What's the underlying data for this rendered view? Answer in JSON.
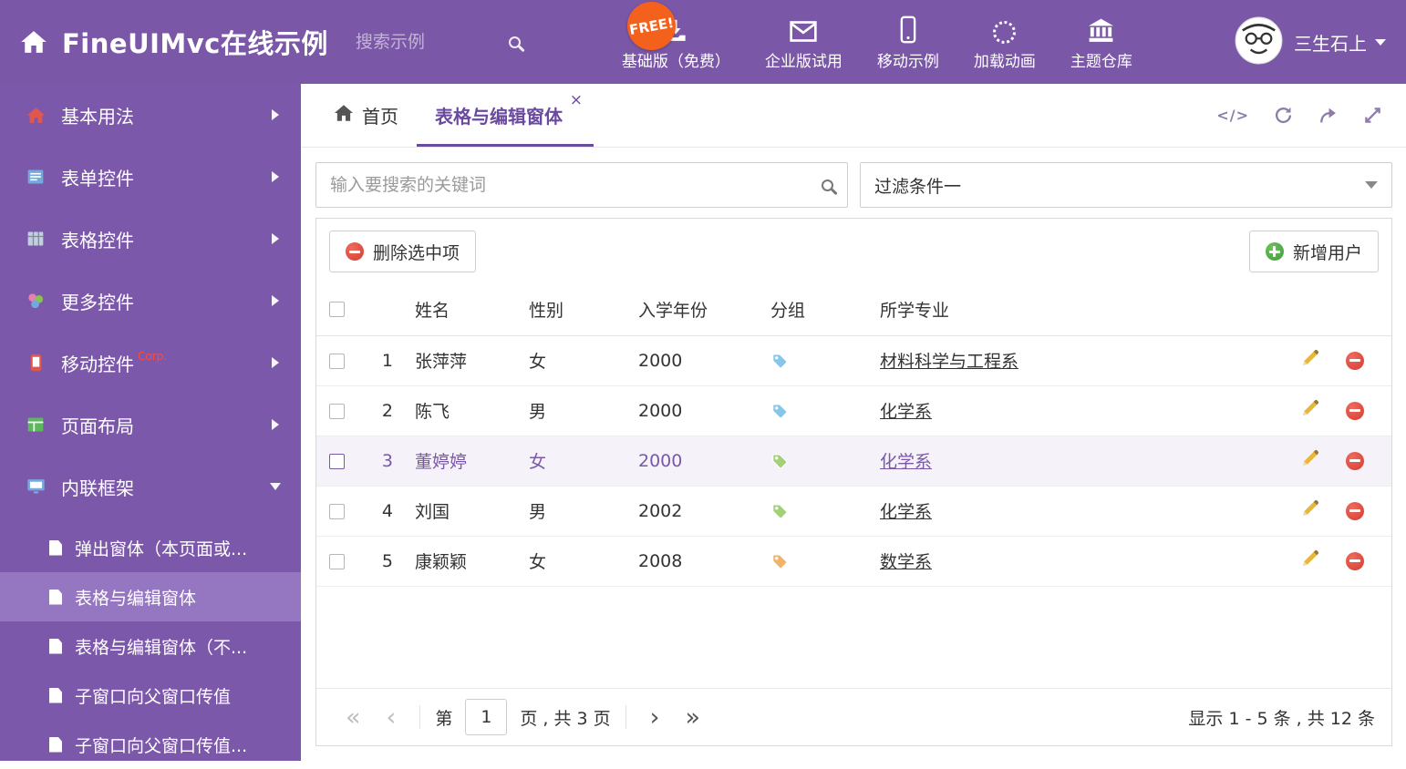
{
  "colors": {
    "accent": "#7a57a7",
    "sidebar_active": "#9577c1",
    "free_badge": "#f4611d",
    "danger": "#d43c30",
    "success": "#3f9e3f"
  },
  "icons": {
    "close": "×",
    "code": "</>",
    "pager_first": "«",
    "pager_prev": "‹",
    "pager_next": "›",
    "pager_last": "»"
  },
  "header": {
    "title": "FineUIMvc在线示例",
    "search_placeholder": "搜索示例",
    "free_badge": "FREE!",
    "nav": [
      {
        "label": "基础版（免费）",
        "icon": "download-icon"
      },
      {
        "label": "企业版试用",
        "icon": "envelope-icon"
      },
      {
        "label": "移动示例",
        "icon": "mobile-icon"
      },
      {
        "label": "加载动画",
        "icon": "spinner-icon"
      },
      {
        "label": "主题仓库",
        "icon": "bank-icon"
      }
    ],
    "user": "三生石上"
  },
  "sidebar": {
    "items": [
      {
        "label": "基本用法"
      },
      {
        "label": "表单控件"
      },
      {
        "label": "表格控件"
      },
      {
        "label": "更多控件"
      },
      {
        "label": "移动控件",
        "badge": "Corp."
      },
      {
        "label": "页面布局"
      },
      {
        "label": "内联框架",
        "expanded": true
      }
    ],
    "subitems": [
      {
        "label": "弹出窗体（本页面或..."
      },
      {
        "label": "表格与编辑窗体",
        "active": true
      },
      {
        "label": "表格与编辑窗体（不..."
      },
      {
        "label": "子窗口向父窗口传值"
      },
      {
        "label": "子窗口向父窗口传值..."
      }
    ]
  },
  "tabs": {
    "home": "首页",
    "active": "表格与编辑窗体"
  },
  "filter": {
    "search_placeholder": "输入要搜索的关键词",
    "dropdown_value": "过滤条件一"
  },
  "toolbar": {
    "delete": "删除选中项",
    "add": "新增用户"
  },
  "table": {
    "headers": [
      "姓名",
      "性别",
      "入学年份",
      "分组",
      "所学专业"
    ],
    "rows": [
      {
        "num": "1",
        "name": "张萍萍",
        "gender": "女",
        "year": "2000",
        "tag_color": "#85c6ea",
        "major": "材料科学与工程系"
      },
      {
        "num": "2",
        "name": "陈飞",
        "gender": "男",
        "year": "2000",
        "tag_color": "#85c6ea",
        "major": "化学系"
      },
      {
        "num": "3",
        "name": "董婷婷",
        "gender": "女",
        "year": "2000",
        "tag_color": "#a3d178",
        "major": "化学系",
        "selected": true
      },
      {
        "num": "4",
        "name": "刘国",
        "gender": "男",
        "year": "2002",
        "tag_color": "#a3d178",
        "major": "化学系"
      },
      {
        "num": "5",
        "name": "康颖颖",
        "gender": "女",
        "year": "2008",
        "tag_color": "#f2b26a",
        "major": "数学系"
      }
    ]
  },
  "pagination": {
    "page_prefix": "第",
    "current_page": "1",
    "page_suffix": "页 , 共 3 页",
    "summary": "显示 1 - 5 条 , 共 12 条"
  }
}
